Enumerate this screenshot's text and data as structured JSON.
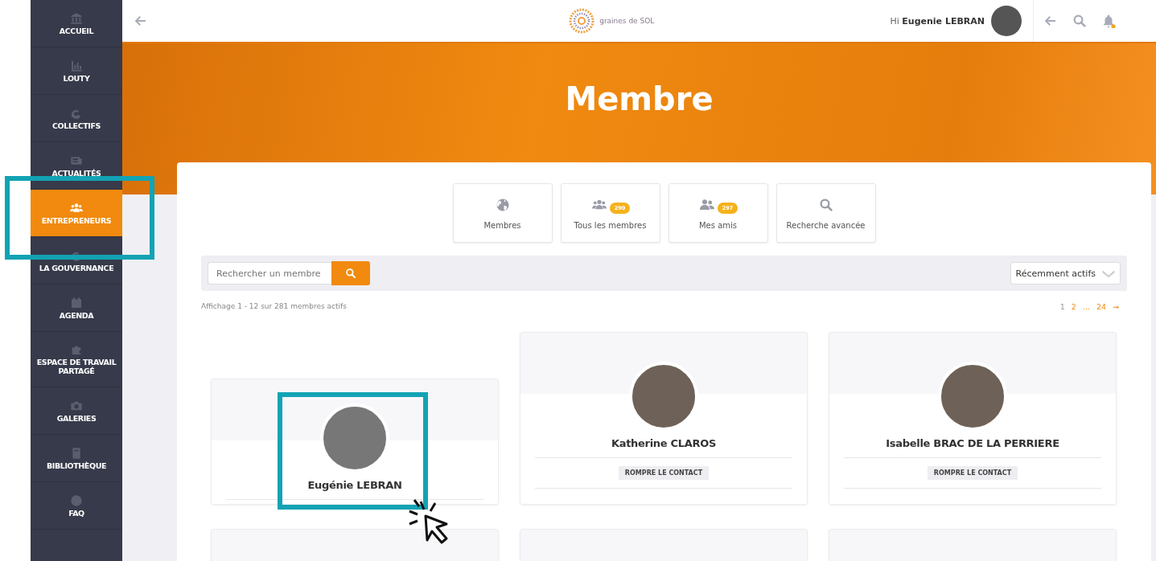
{
  "sidebar": {
    "items": [
      {
        "label": "ACCUEIL",
        "selected": false
      },
      {
        "label": "LOUTY",
        "selected": false
      },
      {
        "label": "COLLECTIFS",
        "selected": false
      },
      {
        "label": "ACTUALITÉS",
        "selected": false
      },
      {
        "label": "ENTREPRENEURS",
        "selected": true
      },
      {
        "label": "LA GOUVERNANCE",
        "selected": false
      },
      {
        "label": "AGENDA",
        "selected": false
      },
      {
        "label": "ESPACE DE TRAVAIL PARTAGÉ",
        "selected": false
      },
      {
        "label": "GALERIES",
        "selected": false
      },
      {
        "label": "BIBLIOTHÈQUE",
        "selected": false
      },
      {
        "label": "FAQ",
        "selected": false
      }
    ]
  },
  "topbar": {
    "logo": "graines de SOL",
    "greeting": "Hi",
    "user": "Eugenie LEBRAN",
    "notification_dot": true
  },
  "banner": {
    "title": "Membre"
  },
  "tabs": [
    {
      "label": "Membres"
    },
    {
      "label": "Tous les membres",
      "badge": "290"
    },
    {
      "label": "Mes amis",
      "badge": "297"
    },
    {
      "label": "Recherche avancée"
    }
  ],
  "search": {
    "placeholder": "Rechercher un membre"
  },
  "sort": {
    "value": "Récemment actifs"
  },
  "summary": "Affichage 1 - 12 sur 281 membres actifs",
  "pagination": [
    {
      "label": "1",
      "selected": true
    },
    {
      "label": "2",
      "selected": false
    },
    {
      "label": "...",
      "selected": false
    },
    {
      "label": "24",
      "selected": false
    },
    {
      "label": "→",
      "selected": false
    }
  ],
  "members": [
    {
      "kind": "full",
      "name": "Eugénie LEBRAN",
      "highlighted": true
    },
    {
      "kind": "full",
      "name": "Katherine CLAROS",
      "action": "ROMPRE LE CONTACT",
      "highlighted": false
    },
    {
      "kind": "full",
      "name": "Isabelle BRAC DE LA PERRIERE",
      "action": "ROMPRE LE CONTACT",
      "highlighted": false
    },
    {
      "kind": "cut"
    },
    {
      "kind": "cut"
    },
    {
      "kind": "cut"
    }
  ]
}
